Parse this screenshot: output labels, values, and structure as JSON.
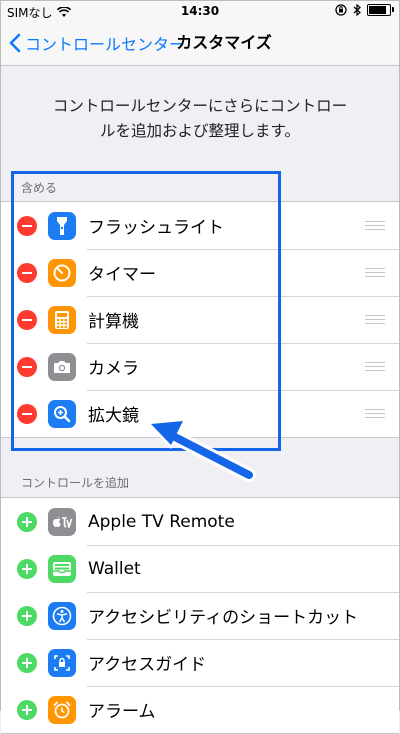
{
  "status_bar": {
    "carrier": "SIMなし",
    "time": "14:30"
  },
  "nav": {
    "back_label": "コントロールセンター",
    "title": "カスタマイズ"
  },
  "description": {
    "line1": "コントロールセンターにさらにコントロー",
    "line2": "ルを追加および整理します。"
  },
  "include_section": {
    "header": "含める",
    "items": [
      {
        "label": "フラッシュライト",
        "icon": "flashlight-icon",
        "color": "#1c7cf3"
      },
      {
        "label": "タイマー",
        "icon": "timer-icon",
        "color": "#ff9500"
      },
      {
        "label": "計算機",
        "icon": "calculator-icon",
        "color": "#ff9500"
      },
      {
        "label": "カメラ",
        "icon": "camera-icon",
        "color": "#8e8e93"
      },
      {
        "label": "拡大鏡",
        "icon": "magnifier-icon",
        "color": "#1c7cf3"
      }
    ]
  },
  "add_section": {
    "header": "コントロールを追加",
    "items": [
      {
        "label": "Apple TV Remote",
        "icon": "apple-tv-icon",
        "color": "#8e8e93"
      },
      {
        "label": "Wallet",
        "icon": "wallet-icon",
        "color": "#4cd964"
      },
      {
        "label": "アクセシビリティのショートカット",
        "icon": "accessibility-icon",
        "color": "#1c7cf3"
      },
      {
        "label": "アクセスガイド",
        "icon": "guided-access-icon",
        "color": "#1c7cf3"
      },
      {
        "label": "アラーム",
        "icon": "alarm-icon",
        "color": "#ff9500"
      }
    ]
  },
  "colors": {
    "accent": "#0a7aff",
    "delete": "#ff3b30",
    "add": "#4cd964",
    "highlight": "#1565e8"
  }
}
